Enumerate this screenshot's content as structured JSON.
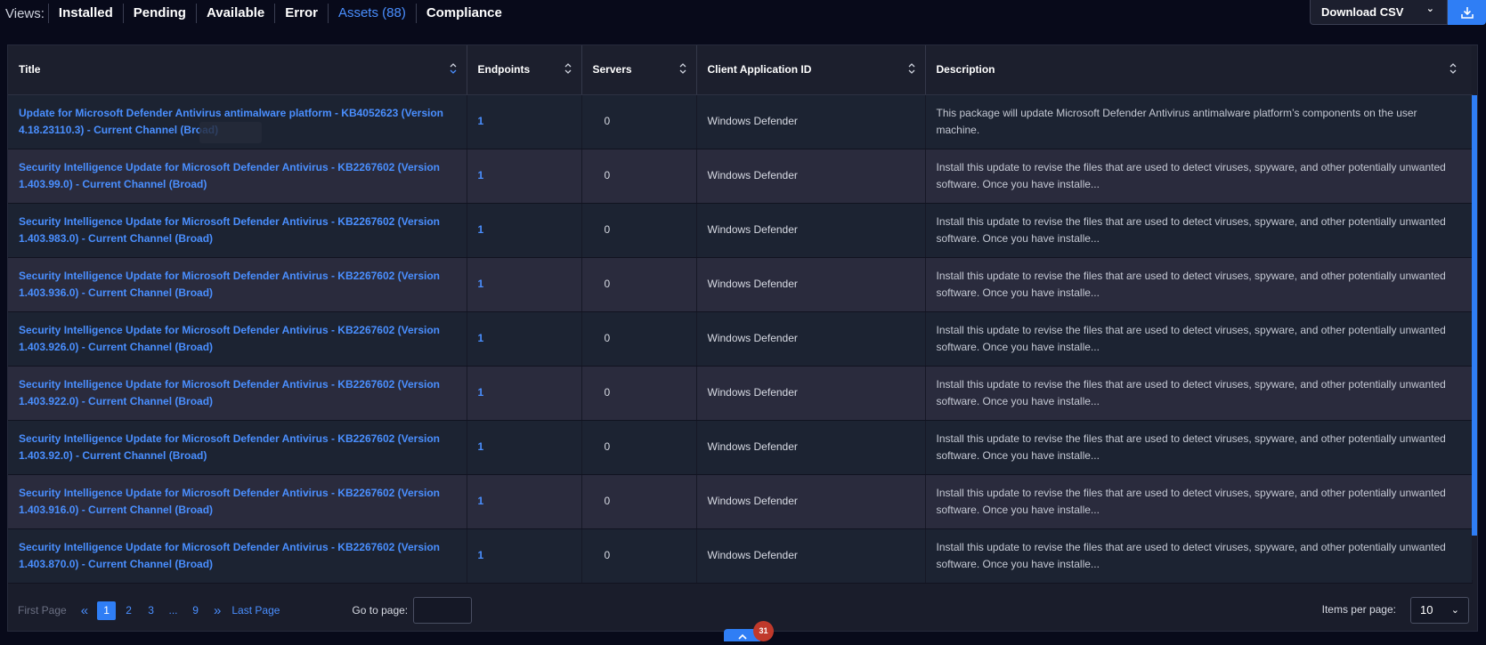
{
  "views": {
    "label": "Views:",
    "tabs": [
      {
        "label": "Installed"
      },
      {
        "label": "Pending"
      },
      {
        "label": "Available"
      },
      {
        "label": "Error"
      },
      {
        "label": "Assets (88)"
      },
      {
        "label": "Compliance"
      }
    ]
  },
  "toolbar": {
    "download_csv_label": "Download CSV"
  },
  "table": {
    "columns": [
      "Title",
      "Endpoints",
      "Servers",
      "Client Application ID",
      "Description"
    ],
    "rows": [
      {
        "title": "Update for Microsoft Defender Antivirus antimalware platform - KB4052623 (Version 4.18.23110.3) - Current Channel (Broad)",
        "endpoints": "1",
        "servers": "0",
        "client": "Windows Defender",
        "description": "This package will update Microsoft Defender Antivirus antimalware platform’s components on the user machine."
      },
      {
        "title": "Security Intelligence Update for Microsoft Defender Antivirus - KB2267602 (Version 1.403.99.0) - Current Channel (Broad)",
        "endpoints": "1",
        "servers": "0",
        "client": "Windows Defender",
        "description": "Install this update to revise the files that are used to detect viruses, spyware, and other potentially unwanted software. Once you have installe..."
      },
      {
        "title": "Security Intelligence Update for Microsoft Defender Antivirus - KB2267602 (Version 1.403.983.0) - Current Channel (Broad)",
        "endpoints": "1",
        "servers": "0",
        "client": "Windows Defender",
        "description": "Install this update to revise the files that are used to detect viruses, spyware, and other potentially unwanted software. Once you have installe..."
      },
      {
        "title": "Security Intelligence Update for Microsoft Defender Antivirus - KB2267602 (Version 1.403.936.0) - Current Channel (Broad)",
        "endpoints": "1",
        "servers": "0",
        "client": "Windows Defender",
        "description": "Install this update to revise the files that are used to detect viruses, spyware, and other potentially unwanted software. Once you have installe..."
      },
      {
        "title": "Security Intelligence Update for Microsoft Defender Antivirus - KB2267602 (Version 1.403.926.0) - Current Channel (Broad)",
        "endpoints": "1",
        "servers": "0",
        "client": "Windows Defender",
        "description": "Install this update to revise the files that are used to detect viruses, spyware, and other potentially unwanted software. Once you have installe..."
      },
      {
        "title": "Security Intelligence Update for Microsoft Defender Antivirus - KB2267602 (Version 1.403.922.0) - Current Channel (Broad)",
        "endpoints": "1",
        "servers": "0",
        "client": "Windows Defender",
        "description": "Install this update to revise the files that are used to detect viruses, spyware, and other potentially unwanted software. Once you have installe..."
      },
      {
        "title": "Security Intelligence Update for Microsoft Defender Antivirus - KB2267602 (Version 1.403.92.0) - Current Channel (Broad)",
        "endpoints": "1",
        "servers": "0",
        "client": "Windows Defender",
        "description": "Install this update to revise the files that are used to detect viruses, spyware, and other potentially unwanted software. Once you have installe..."
      },
      {
        "title": "Security Intelligence Update for Microsoft Defender Antivirus - KB2267602 (Version 1.403.916.0) - Current Channel (Broad)",
        "endpoints": "1",
        "servers": "0",
        "client": "Windows Defender",
        "description": "Install this update to revise the files that are used to detect viruses, spyware, and other potentially unwanted software. Once you have installe..."
      },
      {
        "title": "Security Intelligence Update for Microsoft Defender Antivirus - KB2267602 (Version 1.403.870.0) - Current Channel (Broad)",
        "endpoints": "1",
        "servers": "0",
        "client": "Windows Defender",
        "description": "Install this update to revise the files that are used to detect viruses, spyware, and other potentially unwanted software. Once you have installe..."
      }
    ]
  },
  "pagination": {
    "first_label": "First Page",
    "pages": [
      "1",
      "2",
      "3",
      "...",
      "9"
    ],
    "current_page": "1",
    "last_label": "Last Page",
    "goto_label": "Go to page:",
    "goto_value": "",
    "items_per_page_label": "Items per page:",
    "items_per_page_value": "10"
  },
  "notifications": {
    "badge_count": "31"
  },
  "colors": {
    "accent": "#2f7ef5",
    "link": "#4a8fff",
    "background": "#080a1a",
    "badge": "#c0392b"
  },
  "icons": {
    "sort": "sort-icon",
    "chevron_down": "chevron-down-icon",
    "download": "download-icon",
    "first": "double-chevron-left-icon",
    "last": "double-chevron-right-icon",
    "scroll_top": "chevron-up-icon"
  }
}
